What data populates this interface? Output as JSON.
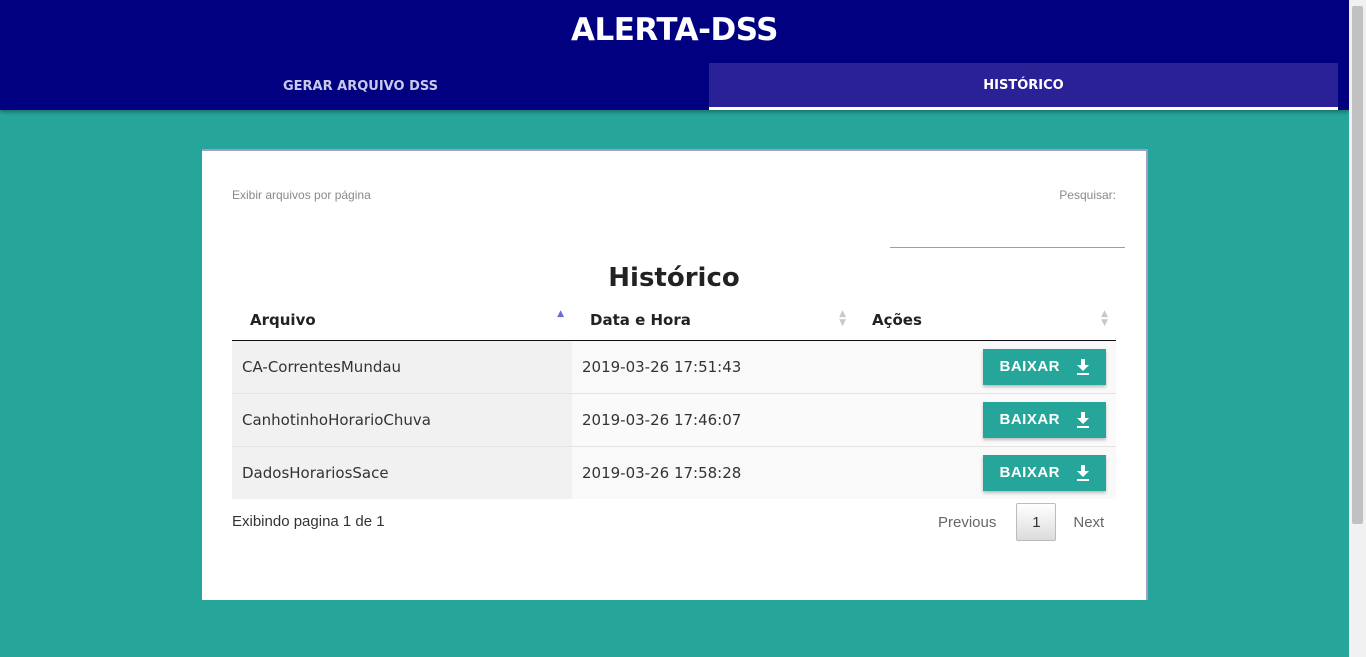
{
  "app": {
    "title": "ALERTA-DSS"
  },
  "tabs": [
    {
      "label": "GERAR ARQUIVO DSS",
      "active": false
    },
    {
      "label": "HISTÓRICO",
      "active": true
    }
  ],
  "table_controls": {
    "per_page_label": "Exibir arquivos por página",
    "search_label": "Pesquisar:",
    "search_value": ""
  },
  "history": {
    "caption": "Histórico",
    "columns": [
      "Arquivo",
      "Data e Hora",
      "Ações"
    ],
    "sorted_column": "Arquivo",
    "rows": [
      {
        "file": "CA-CorrentesMundau",
        "datetime": "2019-03-26 17:51:43",
        "action": "BAIXAR"
      },
      {
        "file": "CanhotinhoHorarioChuva",
        "datetime": "2019-03-26 17:46:07",
        "action": "BAIXAR"
      },
      {
        "file": "DadosHorariosSace",
        "datetime": "2019-03-26 17:58:28",
        "action": "BAIXAR"
      }
    ]
  },
  "pagination": {
    "info": "Exibindo pagina 1 de 1",
    "previous": "Previous",
    "current_page": "1",
    "next": "Next"
  },
  "colors": {
    "background": "#26a69a",
    "header": "#000080",
    "active_tab": "#2a2196",
    "button": "#26a69a"
  },
  "icons": {
    "download": "download-icon"
  }
}
